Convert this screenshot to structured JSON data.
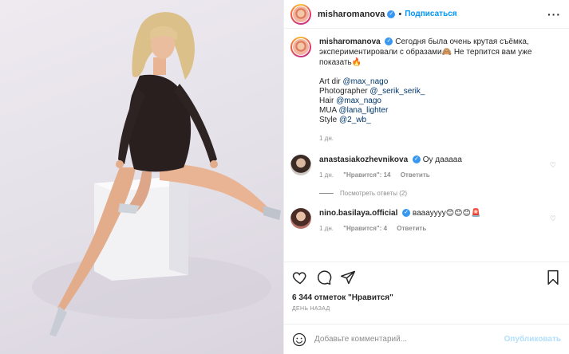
{
  "post": {
    "username": "misharomanova",
    "follow_label": "Подписаться",
    "caption_text": "Сегодня была очень крутая съёмка, экспериментировали с образами🙈 Не терпится вам уже показать🔥",
    "credits": [
      {
        "role": "Art dir",
        "mention": "@max_nago"
      },
      {
        "role": "Photographer",
        "mention": "@_serik_serik_"
      },
      {
        "role": "Hair",
        "mention": "@max_nago"
      },
      {
        "role": "MUA",
        "mention": "@lana_lighter"
      },
      {
        "role": "Style",
        "mention": "@2_wb_"
      }
    ],
    "caption_time": "1 дн."
  },
  "comments": [
    {
      "username": "anastasiakozhevnikova",
      "text": "Оу дааааа",
      "time": "1 дн.",
      "likes": "\"Нравится\": 14",
      "reply": "Ответить",
      "view_replies": "Посмотреть ответы (2)"
    },
    {
      "username": "nino.basilaya.official",
      "text": "вааауууу😊😊😊🚨",
      "time": "1 дн.",
      "likes": "\"Нравится\": 4",
      "reply": "Ответить"
    }
  ],
  "footer": {
    "likes_text": "6 344 отметок \"Нравится\"",
    "date_text": "ДЕНЬ НАЗАД",
    "comment_placeholder": "Добавьте комментарий...",
    "publish_label": "Опубликовать"
  },
  "colors": {
    "link": "#00376b",
    "follow": "#0095f6",
    "muted": "#8e8e8e",
    "verified": "#3897f0"
  },
  "icons": {
    "more": "more-horizontal-icon",
    "heart": "heart-icon",
    "comment": "comment-icon",
    "share": "share-icon",
    "bookmark": "bookmark-icon",
    "smile": "emoji-icon",
    "verified": "verified-badge-icon"
  }
}
